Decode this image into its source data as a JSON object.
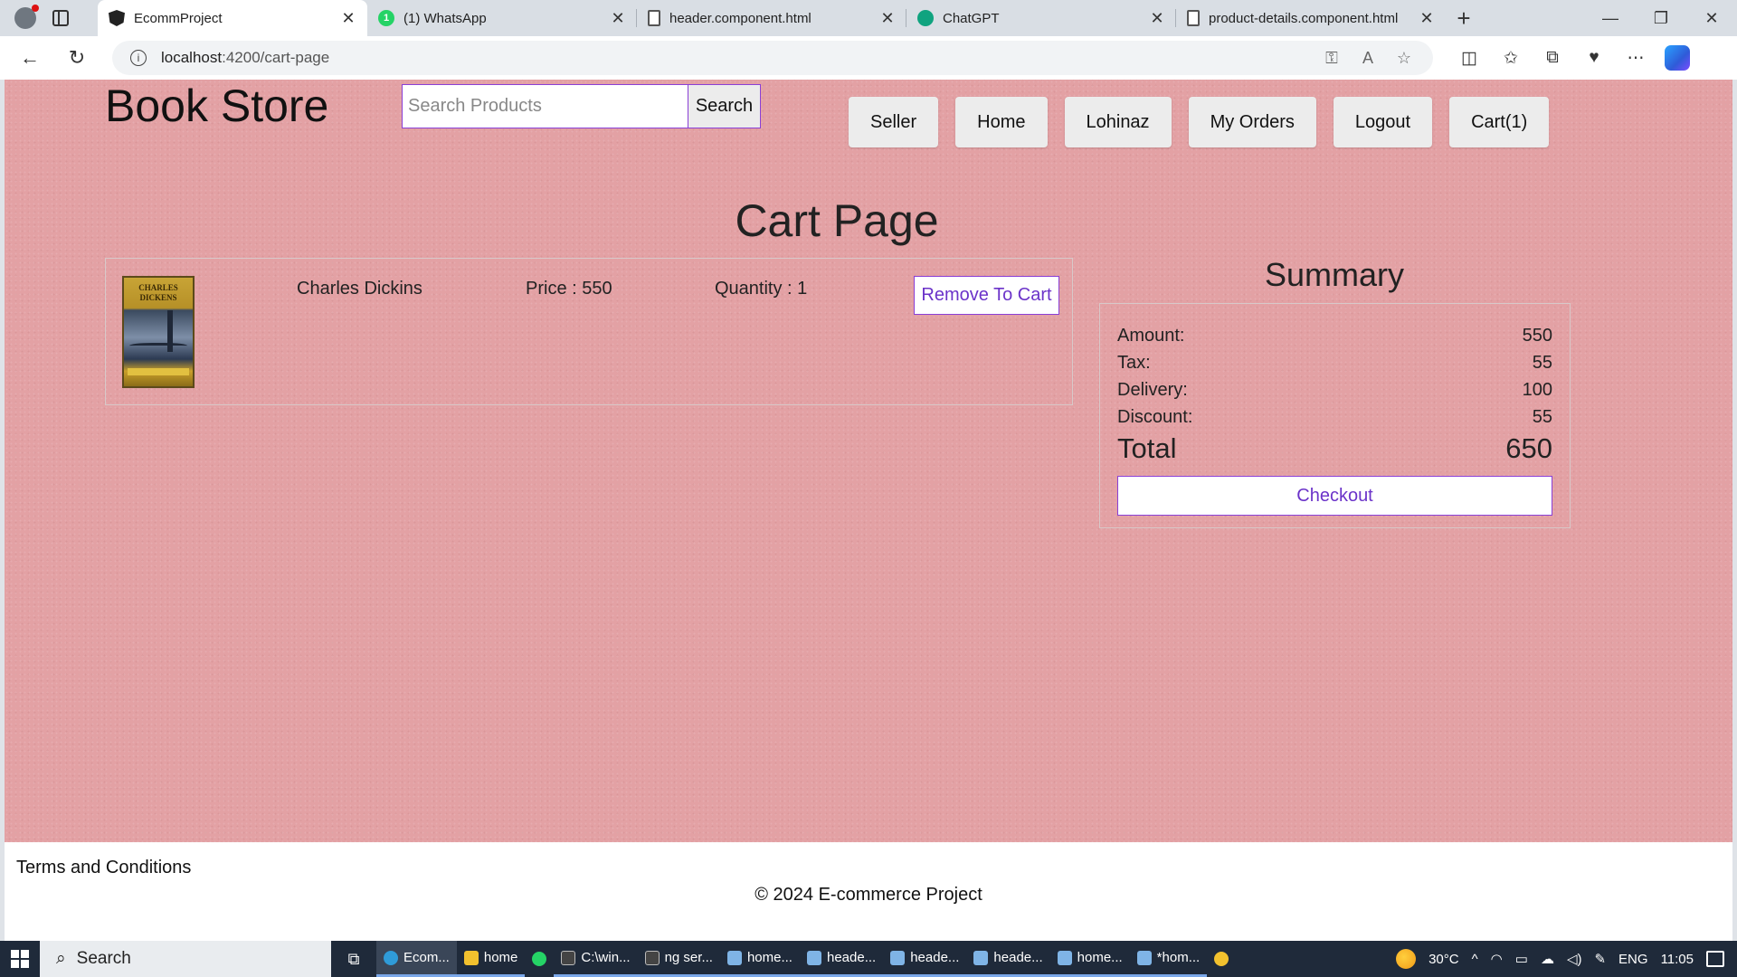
{
  "browser": {
    "tabs": [
      {
        "label": "EcommProject",
        "icon": "angular-icon",
        "active": true
      },
      {
        "label": "(1) WhatsApp",
        "icon": "whatsapp-icon",
        "active": false
      },
      {
        "label": "header.component.html",
        "icon": "file-icon",
        "active": false
      },
      {
        "label": "ChatGPT",
        "icon": "chatgpt-icon",
        "active": false
      },
      {
        "label": "product-details.component.html",
        "icon": "file-icon",
        "active": false
      }
    ],
    "new_tab": "+",
    "close_glyph": "✕",
    "window_controls": {
      "minimize": "—",
      "restore": "❐",
      "close": "✕"
    },
    "url_host": "localhost",
    "url_path": ":4200/cart-page",
    "back_glyph": "←",
    "reload_glyph": "↻",
    "info_glyph": "i"
  },
  "page": {
    "brand": "Book Store",
    "search": {
      "placeholder": "Search Products",
      "value": "",
      "button": "Search"
    },
    "nav": [
      "Seller",
      "Home",
      "Lohinaz",
      "My Orders",
      "Logout",
      "Cart(1)"
    ],
    "title": "Cart Page",
    "cart_items": [
      {
        "cover_title": "CHARLES DICKENS",
        "name": "Charles Dickins",
        "price": "Price : 550",
        "quantity": "Quantity : 1",
        "remove_label": "Remove To Cart"
      }
    ],
    "summary": {
      "title": "Summary",
      "rows": [
        {
          "label": "Amount:",
          "value": "550"
        },
        {
          "label": "Tax:",
          "value": "55"
        },
        {
          "label": "Delivery:",
          "value": "100"
        },
        {
          "label": "Discount:",
          "value": "55"
        }
      ],
      "total_label": "Total",
      "total_value": "650",
      "checkout": "Checkout"
    },
    "footer": {
      "terms": "Terms and Conditions",
      "copyright": "© 2024 E-commerce Project"
    }
  },
  "taskbar": {
    "search": "Search",
    "apps": [
      {
        "label": "Ecom...",
        "active": true,
        "color": "#2f9bd8"
      },
      {
        "label": "home",
        "active": false,
        "color": "#f2c12e"
      },
      {
        "label": "",
        "active": false,
        "color": "#25d366"
      },
      {
        "label": "C:\\win...",
        "active": false,
        "color": "#888888"
      },
      {
        "label": "ng ser...",
        "active": false,
        "color": "#888888"
      },
      {
        "label": "home...",
        "active": false,
        "color": "#7fb4e6"
      },
      {
        "label": "heade...",
        "active": false,
        "color": "#7fb4e6"
      },
      {
        "label": "heade...",
        "active": false,
        "color": "#7fb4e6"
      },
      {
        "label": "heade...",
        "active": false,
        "color": "#7fb4e6"
      },
      {
        "label": "home...",
        "active": false,
        "color": "#7fb4e6"
      },
      {
        "label": "*hom...",
        "active": false,
        "color": "#7fb4e6"
      }
    ],
    "temperature": "30°C",
    "language": "ENG",
    "time": "11:05"
  },
  "colors": {
    "page_background": "#e3a1a4",
    "accent": "#8a3fd6"
  }
}
